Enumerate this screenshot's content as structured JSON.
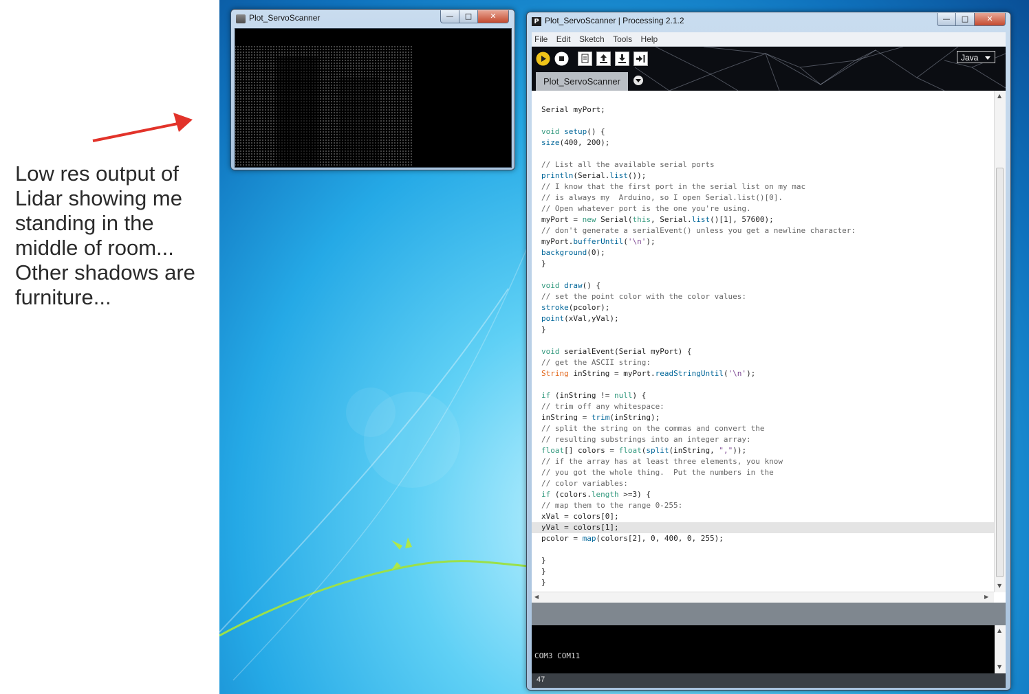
{
  "annotation": {
    "text": "Low res output of Lidar showing me standing in the middle of room... Other shadows are furniture..."
  },
  "plot_window": {
    "title": "Plot_ServoScanner"
  },
  "ide_window": {
    "title": "Plot_ServoScanner | Processing 2.1.2",
    "menu": [
      "File",
      "Edit",
      "Sketch",
      "Tools",
      "Help"
    ],
    "mode": "Java",
    "tab": "Plot_ServoScanner",
    "console_output": "COM3 COM11",
    "status_line": "47"
  },
  "code_lines": [
    "Serial myPort;",
    "",
    "void setup() {",
    "size(400, 200);",
    "",
    "// List all the available serial ports",
    "println(Serial.list());",
    "// I know that the first port in the serial list on my mac",
    "// is always my  Arduino, so I open Serial.list()[0].",
    "// Open whatever port is the one you're using.",
    "myPort = new Serial(this, Serial.list()[1], 57600);",
    "// don't generate a serialEvent() unless you get a newline character:",
    "myPort.bufferUntil('\\n');",
    "background(0);",
    "}",
    "",
    "void draw() {",
    "// set the point color with the color values:",
    "stroke(pcolor);",
    "point(xVal,yVal);",
    "}",
    "",
    "void serialEvent(Serial myPort) {",
    "// get the ASCII string:",
    "String inString = myPort.readStringUntil('\\n');",
    "",
    "if (inString != null) {",
    "// trim off any whitespace:",
    "inString = trim(inString);",
    "// split the string on the commas and convert the",
    "// resulting substrings into an integer array:",
    "float[] colors = float(split(inString, \",\"));",
    "// if the array has at least three elements, you know",
    "// you got the whole thing.  Put the numbers in the",
    "// color variables:",
    "if (colors.length >=3) {",
    "// map them to the range 0-255:",
    "xVal = colors[0];",
    "yVal = colors[1];",
    "pcolor = map(colors[2], 0, 400, 0, 255);",
    "",
    "}",
    "}",
    "}"
  ],
  "colors": {
    "keyword": "#33997e",
    "function": "#006699",
    "comment": "#666666",
    "type": "#e2661a",
    "string": "#7d4793",
    "arrow": "#e2332a"
  }
}
